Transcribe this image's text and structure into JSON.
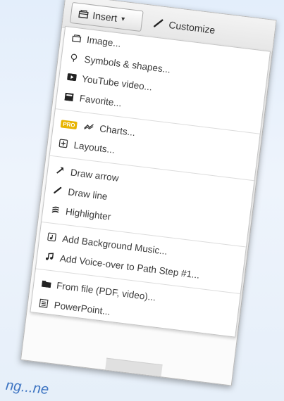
{
  "page": {
    "word": "ng...ne"
  },
  "toolbar": {
    "insert_label": "Insert",
    "insert_icon": "insert-icon",
    "customize_label": "Customize",
    "customize_icon": "brush-icon"
  },
  "menu": {
    "group1": [
      {
        "label": "Image...",
        "icon": "image-icon"
      },
      {
        "label": "Symbols & shapes...",
        "icon": "lightbulb-icon"
      },
      {
        "label": "YouTube video...",
        "icon": "youtube-icon"
      },
      {
        "label": "Favorite...",
        "icon": "favorite-icon"
      }
    ],
    "group2": [
      {
        "badge": "PRO",
        "label": "Charts...",
        "icon": "chart-icon"
      },
      {
        "label": "Layouts...",
        "icon": "plus-box-icon"
      }
    ],
    "group3": [
      {
        "label": "Draw arrow",
        "icon": "arrow-icon"
      },
      {
        "label": "Draw line",
        "icon": "line-icon"
      },
      {
        "label": "Highlighter",
        "icon": "highlighter-icon"
      }
    ],
    "group4": [
      {
        "label": "Add Background Music...",
        "icon": "music-box-icon"
      },
      {
        "label": "Add Voice-over to Path Step #1...",
        "icon": "music-note-icon"
      }
    ],
    "group5": [
      {
        "label": "From file (PDF, video)...",
        "icon": "folder-icon"
      },
      {
        "label": "PowerPoint...",
        "icon": "powerpoint-icon"
      }
    ]
  }
}
